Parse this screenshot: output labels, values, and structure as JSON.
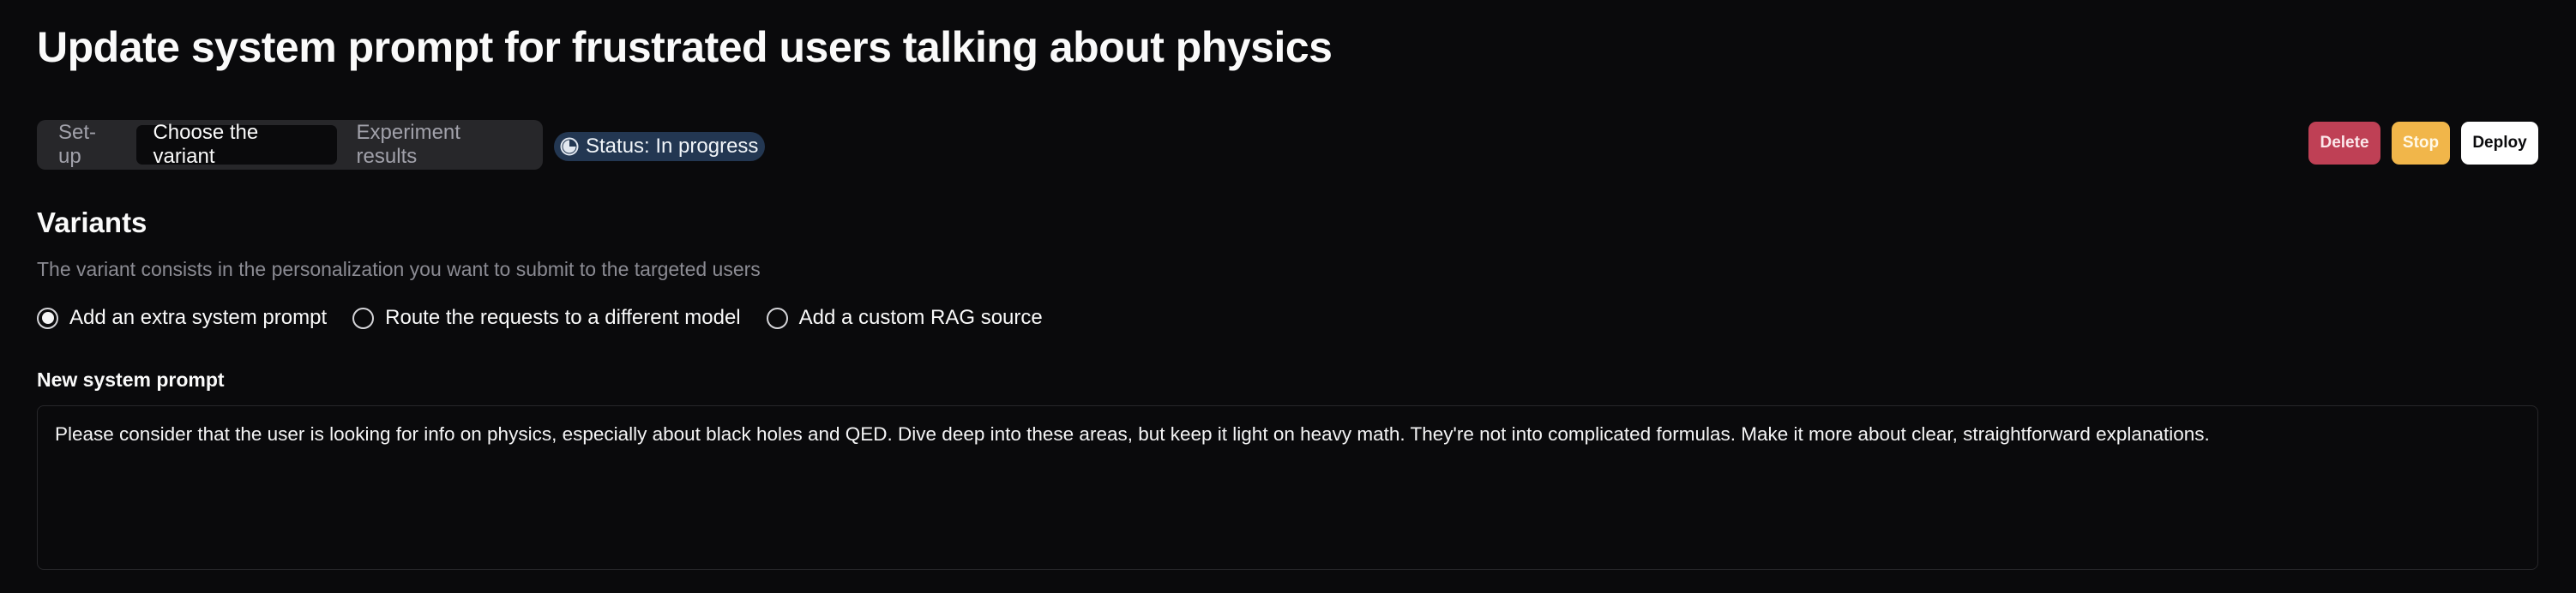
{
  "page": {
    "title": "Update system prompt for frustrated users talking about physics"
  },
  "tabs": [
    {
      "label": "Set-up",
      "active": false
    },
    {
      "label": "Choose the variant",
      "active": true
    },
    {
      "label": "Experiment results",
      "active": false
    }
  ],
  "status": {
    "label": "Status: In progress",
    "icon": "progress-clock-icon"
  },
  "actions": {
    "delete_label": "Delete",
    "stop_label": "Stop",
    "deploy_label": "Deploy"
  },
  "variants": {
    "heading": "Variants",
    "description": "The variant consists in the personalization you want to submit to the targeted users",
    "options": [
      {
        "label": "Add an extra system prompt",
        "selected": true
      },
      {
        "label": "Route the requests to a different model",
        "selected": false
      },
      {
        "label": "Add a custom RAG source",
        "selected": false
      }
    ]
  },
  "prompt": {
    "label": "New system prompt",
    "value": "Please consider that the user is looking for info on physics, especially about black holes and QED. Dive deep into these areas, but keep it light on heavy math. They're not into complicated formulas. Make it more about clear, straightforward explanations."
  },
  "colors": {
    "background": "#0a0a0c",
    "delete": "#bf4055",
    "stop": "#f1b64a",
    "deploy": "#ffffff",
    "status_badge": "#233752"
  }
}
